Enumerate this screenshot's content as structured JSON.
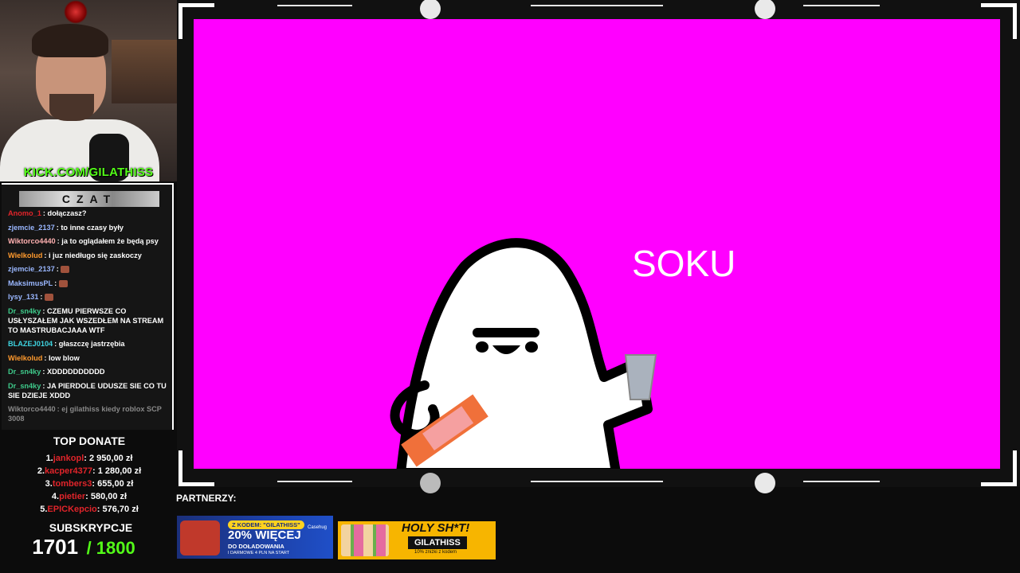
{
  "webcam": {
    "url_prefix": "KICK.COM/",
    "url_handle": "GILATHISS"
  },
  "chat": {
    "title": "CZAT",
    "messages": [
      {
        "user": "Anomo_1",
        "text": "dołączasz?",
        "color": "#e0242a"
      },
      {
        "user": "zjemcie_2137",
        "text": "to inne czasy były",
        "color": "#9ab7ff"
      },
      {
        "user": "Wiktorco4440",
        "text": "ja to oglądałem że będą psy",
        "color": "#ffb0b0"
      },
      {
        "user": "Wielkolud",
        "text": "i juz niedługo się zaskoczy",
        "color": "#ff9a2e"
      },
      {
        "user": "zjemcie_2137",
        "text": "",
        "color": "#9ab7ff",
        "emote": true
      },
      {
        "user": "MaksimusPL",
        "text": "",
        "color": "#9ab7ff",
        "emote": true
      },
      {
        "user": "lysy_131",
        "text": "",
        "color": "#9ab7ff",
        "emote": true
      },
      {
        "user": "Dr_sn4ky",
        "text": "CZEMU PIERWSZE CO USŁYSZAŁEM JAK WSZEDŁEM NA STREAM TO MASTRUBACJAAA WTF",
        "color": "#3ec98a"
      },
      {
        "user": "BLAZEJ0104",
        "text": "głaszczę jastrzębia",
        "color": "#3ed3e0"
      },
      {
        "user": "Wielkolud",
        "text": "low blow",
        "color": "#ff9a2e"
      },
      {
        "user": "Dr_sn4ky",
        "text": "XDDDDDDDDDD",
        "color": "#3ec98a"
      },
      {
        "user": "Dr_sn4ky",
        "text": "JA PIERDOLE UDUSZE SIE CO TU SIE DZIEJE XDDD",
        "color": "#3ec98a"
      },
      {
        "user": "Wiktorco4440",
        "text": "ej gilathiss kiedy roblox SCP 3008",
        "color": "#888888",
        "faded": true
      }
    ]
  },
  "top_donate": {
    "title": "TOP DONATE",
    "items": [
      {
        "rank": "1.",
        "name": "jankopl",
        "amount": ": 2 950,00 zł"
      },
      {
        "rank": "2.",
        "name": "kacper4377",
        "amount": ": 1 280,00 zł"
      },
      {
        "rank": "3.",
        "name": "tombers3",
        "amount": ": 655,00 zł"
      },
      {
        "rank": "4.",
        "name": "pietier",
        "amount": ": 580,00 zł"
      },
      {
        "rank": "5.",
        "name": "EPICKepcio",
        "amount": ": 576,70 zł"
      }
    ]
  },
  "subs": {
    "title": "SUBSKRYPCJE",
    "count": "1701",
    "goal": "/ 1800"
  },
  "stage": {
    "caption": "SOKU",
    "background": "#ff00ff"
  },
  "partners": {
    "label": "PARTNERZY:",
    "ad1": {
      "code": "Z KODEM: \"GILATHISS\"",
      "headline": "20% WIĘCEJ",
      "line1": "DO DOŁADOWANIA",
      "line2": "I DARMOWE 4 PLN NA START",
      "brand": "Casehug"
    },
    "ad2": {
      "headline": "HOLY SH*T!",
      "code": "GILATHISS",
      "discount": "10% zniżki z kodem"
    }
  }
}
